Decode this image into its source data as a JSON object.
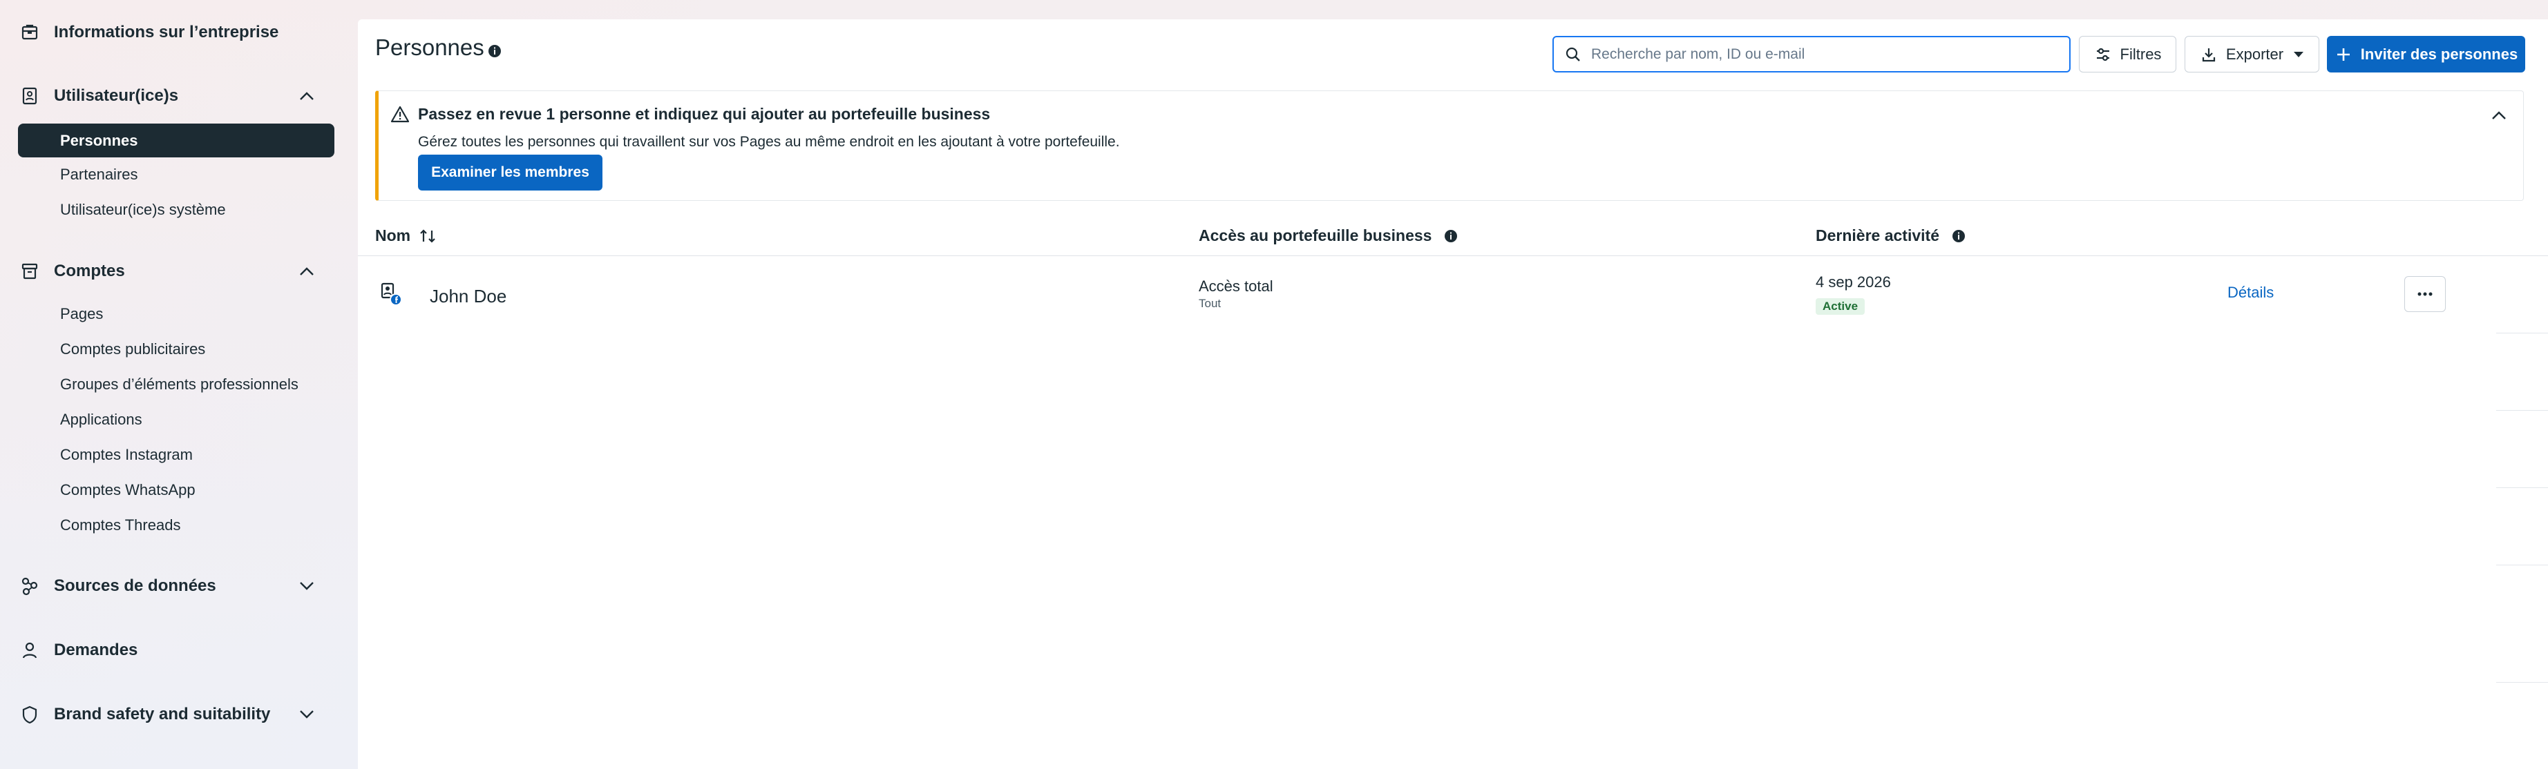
{
  "sidebar": {
    "business_info": "Informations sur l’entreprise",
    "users": {
      "label": "Utilisateur(ice)s",
      "items": [
        "Personnes",
        "Partenaires",
        "Utilisateur(ice)s système"
      ]
    },
    "accounts": {
      "label": "Comptes",
      "items": [
        "Pages",
        "Comptes publicitaires",
        "Groupes d’éléments professionnels",
        "Applications",
        "Comptes Instagram",
        "Comptes WhatsApp",
        "Comptes Threads"
      ]
    },
    "data_sources": "Sources de données",
    "requests": "Demandes",
    "brand_safety": "Brand safety and suitability"
  },
  "header": {
    "title": "Personnes",
    "search_placeholder": "Recherche par nom, ID ou e-mail",
    "filters_label": "Filtres",
    "export_label": "Exporter",
    "invite_label": "Inviter des personnes"
  },
  "banner": {
    "title": "Passez en revue 1 personne et indiquez qui ajouter au portefeuille business",
    "description": "Gérez toutes les personnes qui travaillent sur vos Pages au même endroit en les ajoutant à votre portefeuille.",
    "button_label": "Examiner les membres"
  },
  "table": {
    "columns": [
      "Nom",
      "Accès au portefeuille business",
      "Dernière activité"
    ],
    "rows": [
      {
        "name": "John Doe",
        "access": "Accès total",
        "access_scope": "Tout",
        "last_activity": "4 sep 2026",
        "status": "Active",
        "details_label": "Détails"
      }
    ]
  },
  "colors": {
    "primary": "#0a66c2",
    "nav_active_bg": "#1c2b33",
    "warning": "#f0a30a",
    "status_active_bg": "#e3f4e8",
    "status_active_text": "#1f6f35"
  }
}
